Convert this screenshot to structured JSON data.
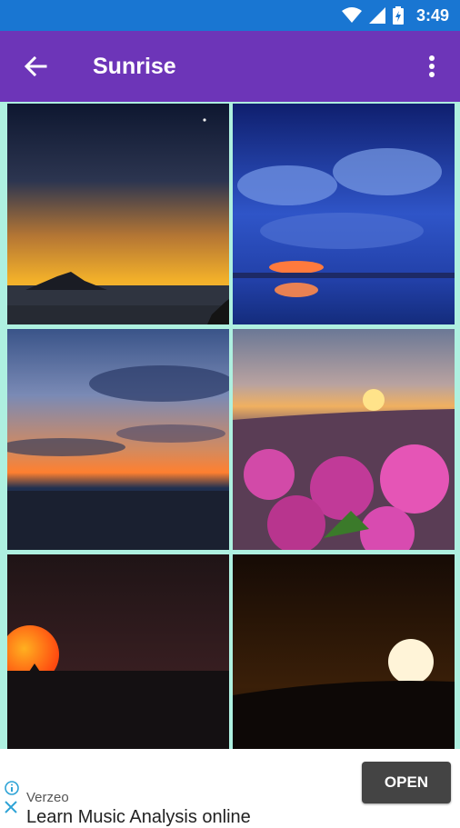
{
  "status_bar": {
    "time": "3:49",
    "icons": [
      "wifi-icon",
      "signal-icon",
      "battery-charging-icon"
    ]
  },
  "app_bar": {
    "title": "Sunrise",
    "back_icon": "arrow-left-icon",
    "menu_icon": "more-vert-icon"
  },
  "gallery": {
    "images": [
      {
        "subject": "mountain-silhouette-dawn",
        "palette": [
          "#0f1a33",
          "#c47a2a",
          "#f0b02a"
        ]
      },
      {
        "subject": "blue-clouds-sun-on-sea",
        "palette": [
          "#1c2f8c",
          "#3f66d6",
          "#ff7a3d"
        ]
      },
      {
        "subject": "sunset-over-sea-clouds",
        "palette": [
          "#2a3e6e",
          "#7d8fb8",
          "#ff8a35"
        ]
      },
      {
        "subject": "pink-flowers-sunrise-hills",
        "palette": [
          "#6b5c7a",
          "#ffd06a",
          "#e040a6"
        ]
      },
      {
        "subject": "red-sun-tree-silhouette",
        "palette": [
          "#1e1416",
          "#3a1e22",
          "#ff5a10"
        ]
      },
      {
        "subject": "white-sun-dark-sky",
        "palette": [
          "#1a0e06",
          "#3a1f08",
          "#fff4d8"
        ]
      }
    ]
  },
  "ad": {
    "advertiser": "Verzeo",
    "headline": "Learn Music Analysis online",
    "cta_label": "OPEN"
  }
}
